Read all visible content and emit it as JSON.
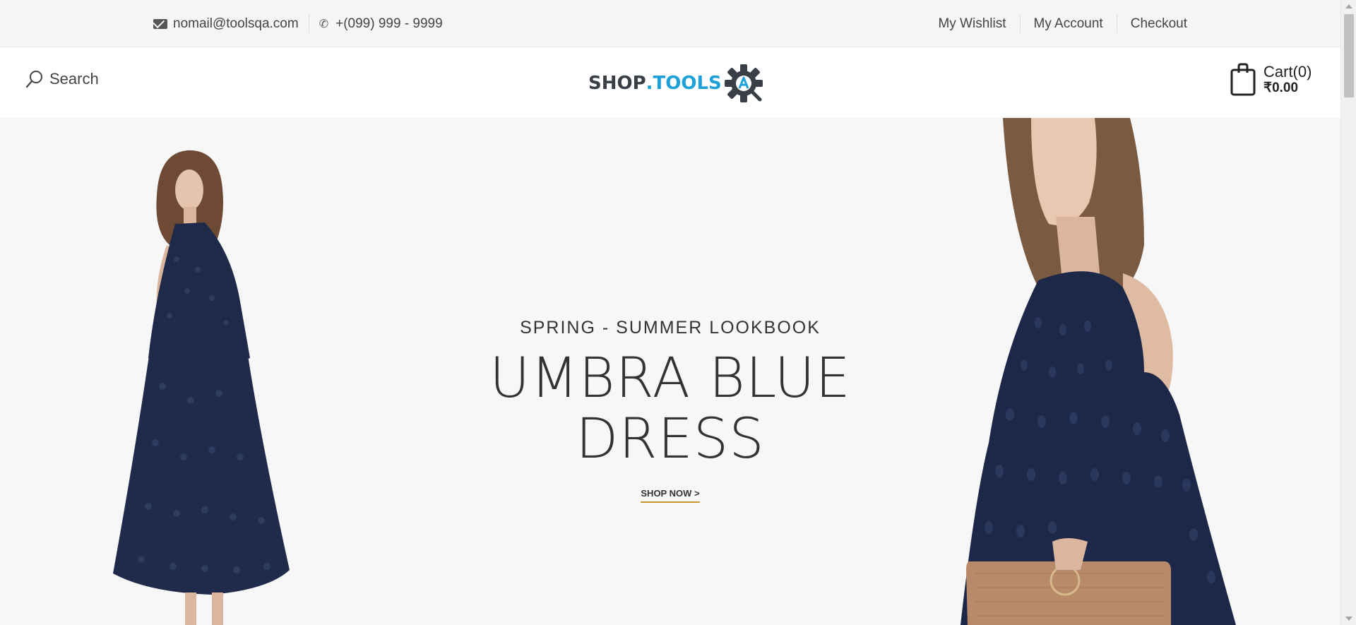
{
  "topbar": {
    "email": "nomail@toolsqa.com",
    "phone": "+(099) 999 - 9999",
    "links": [
      "My Wishlist",
      "My Account",
      "Checkout"
    ]
  },
  "header": {
    "search_label": "Search",
    "logo": {
      "part1": "SHOP",
      "part2": ".TOOLS"
    },
    "cart": {
      "label": "Cart(0)",
      "total": "₹0.00"
    }
  },
  "hero": {
    "subtitle": "SPRING - SUMMER LOOKBOOK",
    "title_line1": "UMBRA BLUE",
    "title_line2": "DRESS",
    "cta": "SHOP NOW >"
  },
  "colors": {
    "accent_underline": "#c99631",
    "logo_blue": "#1ea0d8",
    "dress_navy": "#1f2a4a"
  }
}
